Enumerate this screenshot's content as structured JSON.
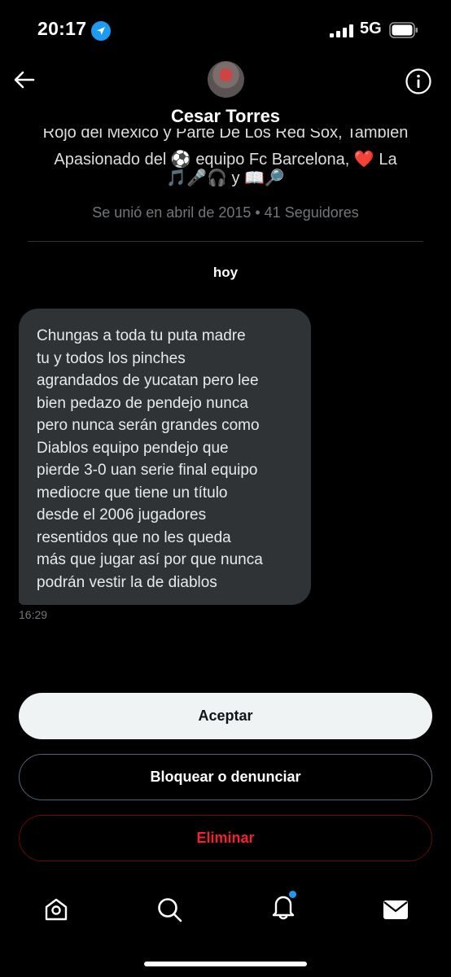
{
  "status": {
    "time": "20:17",
    "network": "5G"
  },
  "profile": {
    "name": "Cesar Torres",
    "bio_partial": "Rojo del Mexico y Parte De Los Red Sox, Tambien",
    "bio_line2": "Apasionado del ⚽ equipo Fc Barcelona, ❤️ La",
    "bio_line3": "🎵🎤🎧 y 📖🔎",
    "joined": "Se unió en abril de 2015 • 41 Seguidores"
  },
  "conversation": {
    "day_label": "hoy",
    "message": "Chungas a toda tu puta madre\ntu y todos los pinches\nagrandados de yucatan pero lee\nbien pedazo de pendejo nunca\npero nunca serán grandes como\nDiablos equipo pendejo que\npierde 3-0 uan serie final equipo\nmediocre que tiene un título\ndesde el 2006 jugadores\nresentidos que no les queda\nmás que jugar así por que nunca\npodrán vestir la de diablos",
    "time": "16:29"
  },
  "actions": {
    "accept": "Aceptar",
    "block_report": "Bloquear o denunciar",
    "delete": "Eliminar"
  },
  "colors": {
    "accent": "#1d9bf0",
    "danger": "#f4212e",
    "bubble": "#2f3336"
  }
}
